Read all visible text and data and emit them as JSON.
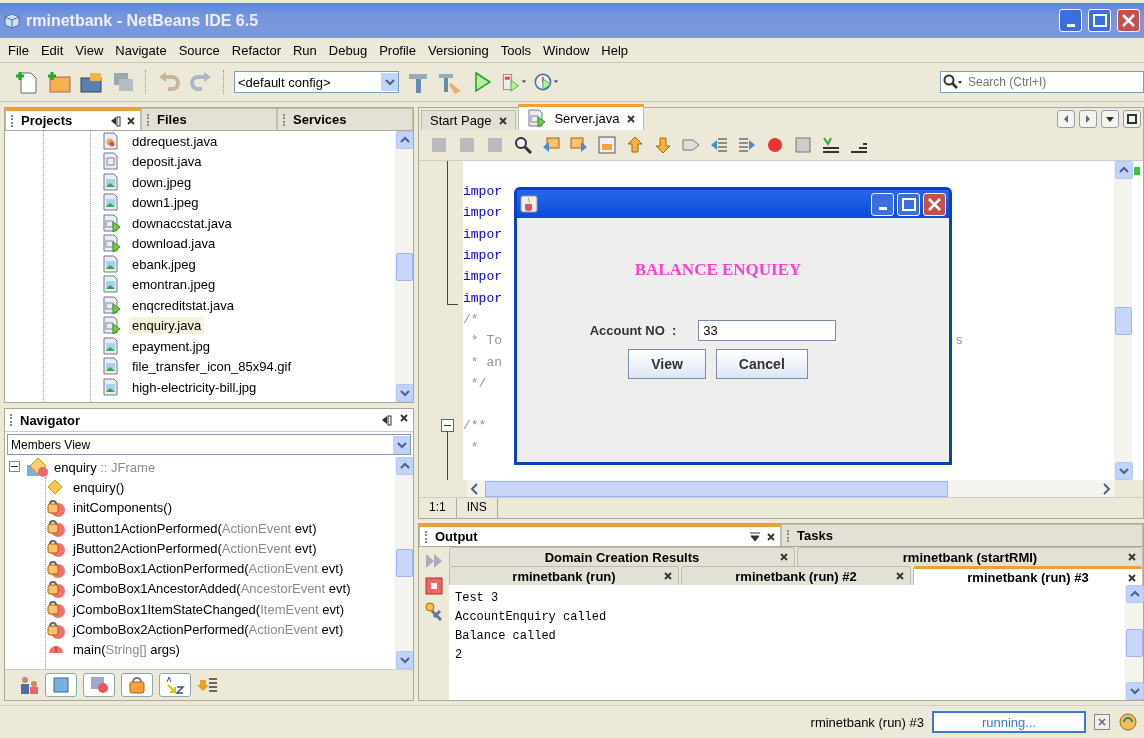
{
  "window": {
    "title": "rminetbank - NetBeans IDE 6.5"
  },
  "menu": [
    "File",
    "Edit",
    "View",
    "Navigate",
    "Source",
    "Refactor",
    "Run",
    "Debug",
    "Profile",
    "Versioning",
    "Tools",
    "Window",
    "Help"
  ],
  "toolbar": {
    "config": "<default config>",
    "search_placeholder": "Search (Ctrl+I)"
  },
  "projects_panel": {
    "tabs": [
      {
        "label": "Projects",
        "selected": true
      },
      {
        "label": "Files",
        "selected": false
      },
      {
        "label": "Services",
        "selected": false
      }
    ],
    "files": [
      {
        "name": "ddrequest.java",
        "kind": "bean",
        "selected": false
      },
      {
        "name": "deposit.java",
        "kind": "class",
        "selected": false
      },
      {
        "name": "down.jpeg",
        "kind": "image",
        "selected": false
      },
      {
        "name": "down1.jpeg",
        "kind": "image",
        "selected": false
      },
      {
        "name": "downaccstat.java",
        "kind": "runnable",
        "selected": false
      },
      {
        "name": "download.java",
        "kind": "runnable",
        "selected": false
      },
      {
        "name": "ebank.jpeg",
        "kind": "image",
        "selected": false
      },
      {
        "name": "emontran.jpeg",
        "kind": "image",
        "selected": false
      },
      {
        "name": "enqcreditstat.java",
        "kind": "runnable",
        "selected": false
      },
      {
        "name": "enquiry.java",
        "kind": "runnable",
        "selected": true
      },
      {
        "name": "epayment.jpg",
        "kind": "image",
        "selected": false
      },
      {
        "name": "file_transfer_icon_85x94.gif",
        "kind": "image",
        "selected": false
      },
      {
        "name": "high-electricity-bill.jpg",
        "kind": "image",
        "selected": false
      }
    ]
  },
  "navigator": {
    "title": "Navigator",
    "view": "Members View",
    "root": {
      "name": "enquiry",
      "type": ":: JFrame",
      "expanded": true,
      "children": [
        {
          "kind": "constructor",
          "name": "enquiry()"
        },
        {
          "kind": "method",
          "name": "initComponents()"
        },
        {
          "kind": "method",
          "name": "jButton1ActionPerformed(",
          "param_type": "ActionEvent",
          "rest": " evt)"
        },
        {
          "kind": "method",
          "name": "jButton2ActionPerformed(",
          "param_type": "ActionEvent",
          "rest": " evt)"
        },
        {
          "kind": "method",
          "name": "jComboBox1ActionPerformed(",
          "param_type": "ActionEvent",
          "rest": " evt)"
        },
        {
          "kind": "method",
          "name": "jComboBox1AncestorAdded(",
          "param_type": "AncestorEvent",
          "rest": " evt)"
        },
        {
          "kind": "method",
          "name": "jComboBox1ItemStateChanged(",
          "param_type": "ItemEvent",
          "rest": " evt)"
        },
        {
          "kind": "method",
          "name": "jComboBox2ActionPerformed(",
          "param_type": "ActionEvent",
          "rest": " evt)"
        },
        {
          "kind": "static",
          "name": "main(",
          "param_type": "String[]",
          "rest": " args)"
        }
      ]
    }
  },
  "editor": {
    "tabs": [
      {
        "label": "Start Page",
        "selected": false
      },
      {
        "label": "Server.java",
        "selected": true
      }
    ],
    "code_lines": [
      {
        "kind": "keyword",
        "text": "impor"
      },
      {
        "kind": "keyword",
        "text": "impor"
      },
      {
        "kind": "keyword",
        "text": "impor"
      },
      {
        "kind": "keyword",
        "text": "impor"
      },
      {
        "kind": "keyword",
        "text": "impor"
      },
      {
        "kind": "keyword",
        "text": "impor"
      },
      {
        "kind": "comment",
        "text": "/*"
      },
      {
        "kind": "comment",
        "text": " * To",
        "right": "s"
      },
      {
        "kind": "comment",
        "text": " * an"
      },
      {
        "kind": "comment",
        "text": " */"
      },
      {
        "kind": "blank"
      },
      {
        "kind": "comment",
        "text": "/**",
        "fold": true
      },
      {
        "kind": "comment",
        "text": " *"
      }
    ],
    "position": "1:1",
    "mode": "INS"
  },
  "dialog": {
    "heading": "BALANCE ENQUIEY",
    "label": "Account NO  :",
    "value": "33",
    "buttons": [
      "View",
      "Cancel"
    ]
  },
  "output": {
    "tabs": [
      {
        "label": "Output",
        "selected": true
      },
      {
        "label": "Tasks",
        "selected": false
      }
    ],
    "run_tabs": [
      [
        {
          "label": "Domain Creation Results",
          "selected": false
        },
        {
          "label": "rminetbank (startRMI)",
          "selected": false
        }
      ],
      [
        {
          "label": "rminetbank (run)",
          "selected": false
        },
        {
          "label": "rminetbank (run) #2",
          "selected": false
        },
        {
          "label": "rminetbank (run) #3",
          "selected": true
        }
      ]
    ],
    "lines": [
      "Test 3",
      "AccountEnquiry called",
      "Balance called",
      "2"
    ]
  },
  "status_bar": {
    "task": "rminetbank (run) #3",
    "progress_text": "running..."
  }
}
